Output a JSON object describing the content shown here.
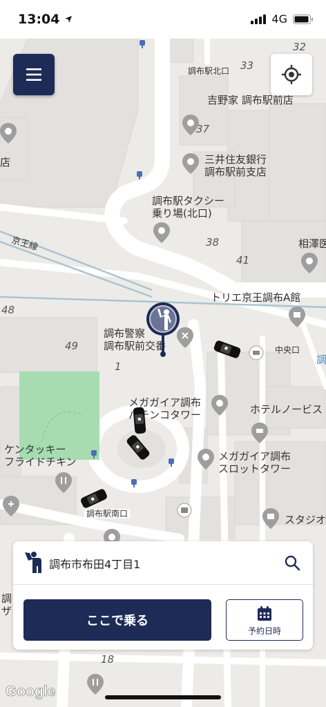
{
  "status_bar": {
    "time": "13:04",
    "network": "4G"
  },
  "map": {
    "places": {
      "station_north": "調布駅北口",
      "yoshinoya": "吉野家 調布駅前店",
      "smbc": "三井住友銀行\n調布駅前支店",
      "taxi_stand": "調布駅タクシー\n乗り場(北口)",
      "keio_line": "京王線",
      "torie": "トリエ京王調布A館",
      "police_box": "調布警察\n調布駅前交番",
      "chuo_exit": "中央口",
      "megagaia_tower": "メガガイア調布\nパチンコタワー",
      "hotel": "ホテルノービス",
      "megagaia_slot": "メガガイア調布\nスロットタワー",
      "kfc": "ケンタッキー\nフライドチキン",
      "station_south": "調布駅南口",
      "studio": "スタジオ",
      "aizawa": "相澤医",
      "edge_ten": "店",
      "edge_cho": "調",
      "edge_cho_za": "調\nザ"
    },
    "block_numbers": [
      "32",
      "33",
      "37",
      "38",
      "41",
      "48",
      "49",
      "1",
      "18"
    ]
  },
  "panel": {
    "address": "調布市布田4丁目1",
    "ride_button": "ここで乗る",
    "reserve_button": "予約日時"
  },
  "google_logo": "Google",
  "colors": {
    "brand_navy": "#1e2b57",
    "map_bg": "#ecebe8",
    "park": "#a6dcb0"
  }
}
